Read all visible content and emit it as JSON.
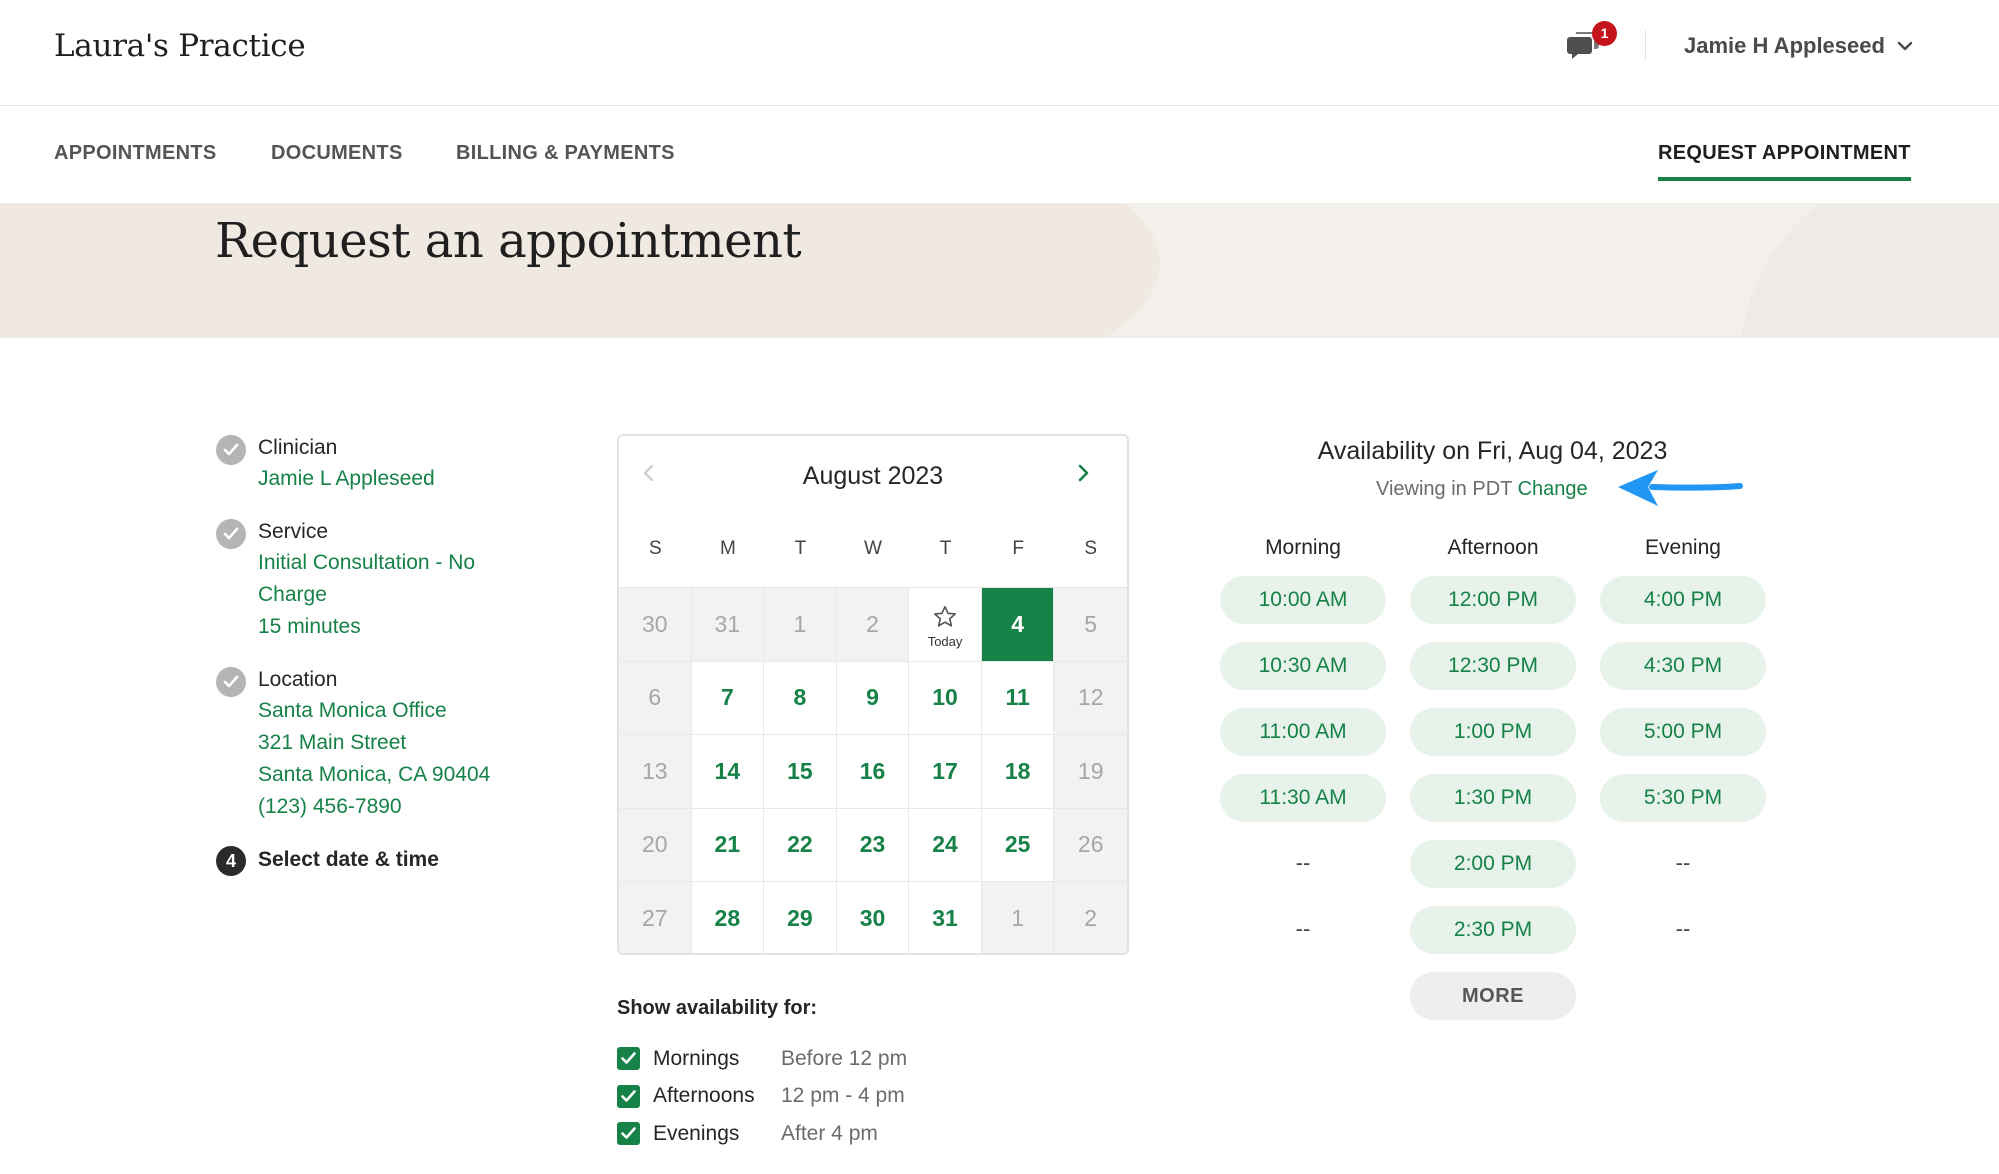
{
  "header": {
    "brand": "Laura's Practice",
    "notification_count": "1",
    "user_name": "Jamie H Appleseed"
  },
  "nav": {
    "items": [
      {
        "label": "APPOINTMENTS"
      },
      {
        "label": "DOCUMENTS"
      },
      {
        "label": "BILLING & PAYMENTS"
      }
    ],
    "request_label": "REQUEST APPOINTMENT"
  },
  "hero": {
    "title": "Request an appointment"
  },
  "steps": {
    "clinician": {
      "label": "Clinician",
      "value": "Jamie L Appleseed"
    },
    "service": {
      "label": "Service",
      "value_line1": "Initial Consultation - No",
      "value_line2": "Charge",
      "duration": "15 minutes"
    },
    "location": {
      "label": "Location",
      "name": "Santa Monica Office",
      "street": "321 Main Street",
      "city": "Santa Monica, CA 90404",
      "phone": "(123) 456-7890"
    },
    "current": {
      "number": "4",
      "label": "Select date & time"
    }
  },
  "calendar": {
    "month": "August 2023",
    "dow": [
      "S",
      "M",
      "T",
      "W",
      "T",
      "F",
      "S"
    ],
    "today_label": "Today",
    "days": [
      {
        "d": "30",
        "s": "off"
      },
      {
        "d": "31",
        "s": "off"
      },
      {
        "d": "1",
        "s": "off"
      },
      {
        "d": "2",
        "s": "off"
      },
      {
        "d": "",
        "s": "today"
      },
      {
        "d": "4",
        "s": "sel"
      },
      {
        "d": "5",
        "s": "off"
      },
      {
        "d": "6",
        "s": "off"
      },
      {
        "d": "7",
        "s": "avail"
      },
      {
        "d": "8",
        "s": "avail"
      },
      {
        "d": "9",
        "s": "avail"
      },
      {
        "d": "10",
        "s": "avail"
      },
      {
        "d": "11",
        "s": "avail"
      },
      {
        "d": "12",
        "s": "off"
      },
      {
        "d": "13",
        "s": "off"
      },
      {
        "d": "14",
        "s": "avail"
      },
      {
        "d": "15",
        "s": "avail"
      },
      {
        "d": "16",
        "s": "avail"
      },
      {
        "d": "17",
        "s": "avail"
      },
      {
        "d": "18",
        "s": "avail"
      },
      {
        "d": "19",
        "s": "off"
      },
      {
        "d": "20",
        "s": "off"
      },
      {
        "d": "21",
        "s": "avail"
      },
      {
        "d": "22",
        "s": "avail"
      },
      {
        "d": "23",
        "s": "avail"
      },
      {
        "d": "24",
        "s": "avail"
      },
      {
        "d": "25",
        "s": "avail"
      },
      {
        "d": "26",
        "s": "off"
      },
      {
        "d": "27",
        "s": "off"
      },
      {
        "d": "28",
        "s": "avail"
      },
      {
        "d": "29",
        "s": "avail"
      },
      {
        "d": "30",
        "s": "avail"
      },
      {
        "d": "31",
        "s": "avail"
      },
      {
        "d": "1",
        "s": "off"
      },
      {
        "d": "2",
        "s": "off"
      }
    ]
  },
  "filters": {
    "heading": "Show availability for:",
    "items": [
      {
        "name": "Mornings",
        "desc": "Before 12 pm",
        "checked": true
      },
      {
        "name": "Afternoons",
        "desc": "12 pm - 4 pm",
        "checked": true
      },
      {
        "name": "Evenings",
        "desc": "After 4 pm",
        "checked": true
      }
    ]
  },
  "availability": {
    "title": "Availability on Fri, Aug 04, 2023",
    "tz_text": "Viewing in PDT",
    "tz_change": "Change",
    "columns": [
      {
        "name": "Morning",
        "slots": [
          "10:00 AM",
          "10:30 AM",
          "11:00 AM",
          "11:30 AM",
          "--",
          "--"
        ]
      },
      {
        "name": "Afternoon",
        "slots": [
          "12:00 PM",
          "12:30 PM",
          "1:00 PM",
          "1:30 PM",
          "2:00 PM",
          "2:30 PM"
        ]
      },
      {
        "name": "Evening",
        "slots": [
          "4:00 PM",
          "4:30 PM",
          "5:00 PM",
          "5:30 PM",
          "--",
          "--"
        ]
      }
    ],
    "more_label": "MORE"
  },
  "colors": {
    "accent": "#168247",
    "slot_bg": "#e6f2ea",
    "annotation_arrow": "#2196f3",
    "badge": "#c4141b"
  }
}
